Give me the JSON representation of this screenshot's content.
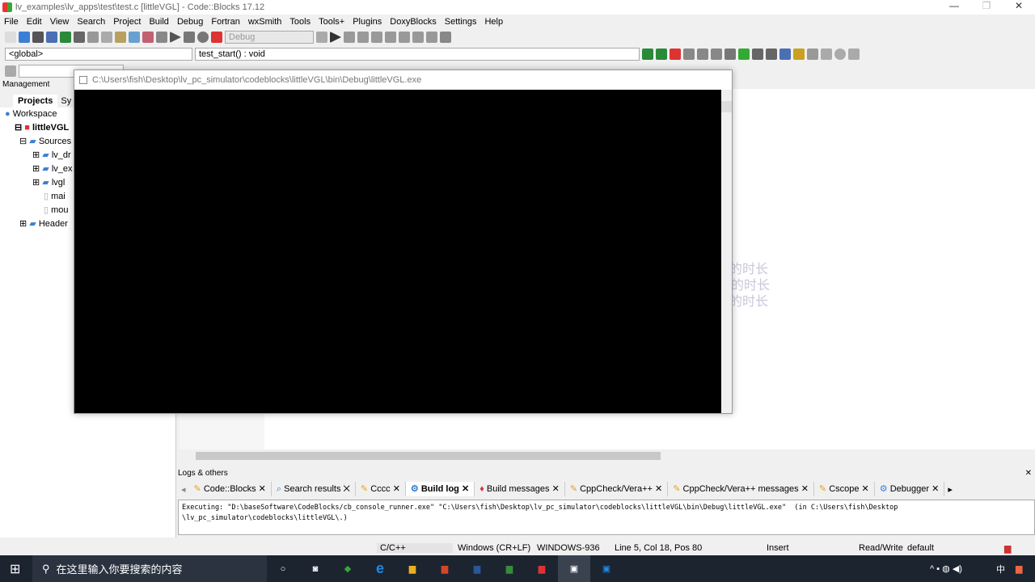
{
  "window": {
    "title": "lv_examples\\lv_apps\\test\\test.c [littleVGL] - Code::Blocks 17.12"
  },
  "menu": [
    "File",
    "Edit",
    "View",
    "Search",
    "Project",
    "Build",
    "Debug",
    "Fortran",
    "wxSmith",
    "Tools",
    "Tools+",
    "Plugins",
    "DoxyBlocks",
    "Settings",
    "Help"
  ],
  "toolbar": {
    "build_target": "Debug",
    "scope": "<global>",
    "function": "test_start() : void"
  },
  "management": {
    "title": "Management",
    "tabs": [
      "Projects",
      "Sy"
    ],
    "tree": [
      "Workspace",
      "littleVGL",
      "Sources",
      "lv_dr",
      "lv_ex",
      "lvgl",
      "mai",
      "mou",
      "Header"
    ]
  },
  "console": {
    "title": "C:\\Users\\fish\\Desktop\\lv_pc_simulator\\codeblocks\\littleVGL\\bin\\Debug\\littleVGL.exe"
  },
  "editor": {
    "ghost_lines": [
      "的时长",
      "待的时长",
      "的时长"
    ]
  },
  "logs": {
    "title": "Logs & others",
    "tabs": [
      "Code::Blocks",
      "Search results",
      "Cccc",
      "Build log",
      "Build messages",
      "CppCheck/Vera++",
      "CppCheck/Vera++ messages",
      "Cscope",
      "Debugger"
    ],
    "active_tab": "Build log",
    "text": "Executing: \"D:\\baseSoftware\\CodeBlocks/cb_console_runner.exe\" \"C:\\Users\\fish\\Desktop\\lv_pc_simulator\\codeblocks\\littleVGL\\bin\\Debug\\littleVGL.exe\"  (in C:\\Users\\fish\\Desktop\n\\lv_pc_simulator\\codeblocks\\littleVGL\\.)"
  },
  "status": {
    "lang": "C/C++",
    "eol": "Windows (CR+LF)",
    "encoding": "WINDOWS-936",
    "position": "Line 5, Col 18, Pos 80",
    "mode": "Insert",
    "access": "Read/Write",
    "profile": "default"
  },
  "taskbar": {
    "search_placeholder": "在这里输入你要搜索的内容",
    "ime": "中"
  }
}
